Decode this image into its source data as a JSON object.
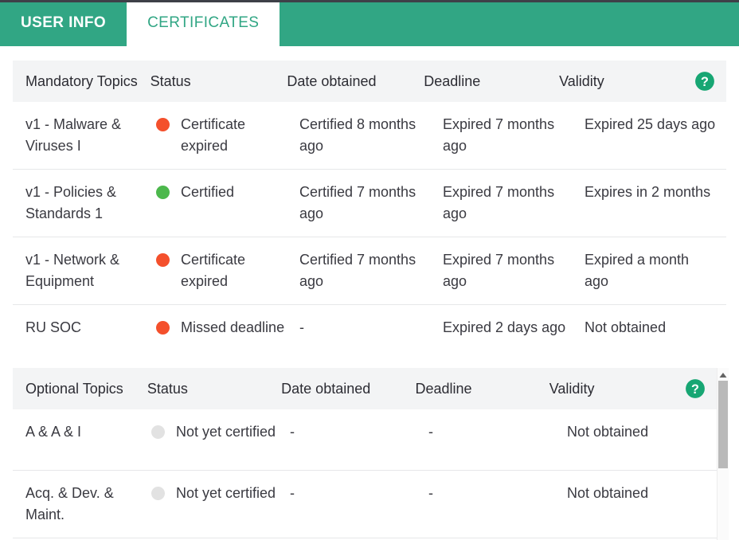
{
  "tabs": [
    {
      "label": "USER INFO",
      "active": false
    },
    {
      "label": "CERTIFICATES",
      "active": true
    }
  ],
  "colors": {
    "brand_green": "#31a684",
    "status_red": "#f4502c",
    "status_green": "#4cb84c",
    "status_grey": "#e2e2e2",
    "header_bg": "#f3f4f5"
  },
  "mandatory_table": {
    "columns": [
      "Mandatory Topics",
      "Status",
      "Date obtained",
      "Deadline",
      "Validity"
    ],
    "help_tooltip_icon": "question-mark-circle-icon",
    "rows": [
      {
        "topic": "v1 - Malware & Viruses I",
        "status": "Certificate expired",
        "status_color": "#f4502c",
        "date_obtained": "Certified 8 months ago",
        "deadline": "Expired 7 months ago",
        "validity": "Expired 25 days ago"
      },
      {
        "topic": "v1 - Policies & Standards 1",
        "status": "Certified",
        "status_color": "#4cb84c",
        "date_obtained": "Certified 7 months ago",
        "deadline": "Expired 7 months ago",
        "validity": "Expires in 2 months"
      },
      {
        "topic": "v1 - Network & Equipment",
        "status": "Certificate expired",
        "status_color": "#f4502c",
        "date_obtained": "Certified 7 months ago",
        "deadline": "Expired 7 months ago",
        "validity": "Expired a month ago"
      },
      {
        "topic": "RU SOC",
        "status": "Missed deadline",
        "status_color": "#f4502c",
        "date_obtained": "-",
        "deadline": "Expired 2 days ago",
        "validity": "Not obtained"
      }
    ]
  },
  "optional_table": {
    "columns": [
      "Optional Topics",
      "Status",
      "Date obtained",
      "Deadline",
      "Validity"
    ],
    "help_tooltip_icon": "question-mark-circle-icon",
    "rows": [
      {
        "topic": "A & A & I",
        "status": "Not yet certified",
        "status_color": "#e2e2e2",
        "date_obtained": "-",
        "deadline": "-",
        "validity": "Not obtained"
      },
      {
        "topic": "Acq. & Dev. & Maint.",
        "status": "Not yet certified",
        "status_color": "#e2e2e2",
        "date_obtained": "-",
        "deadline": "-",
        "validity": "Not obtained"
      }
    ]
  },
  "scrollbar": {
    "up_arrow_icon": "chevron-up-icon"
  }
}
